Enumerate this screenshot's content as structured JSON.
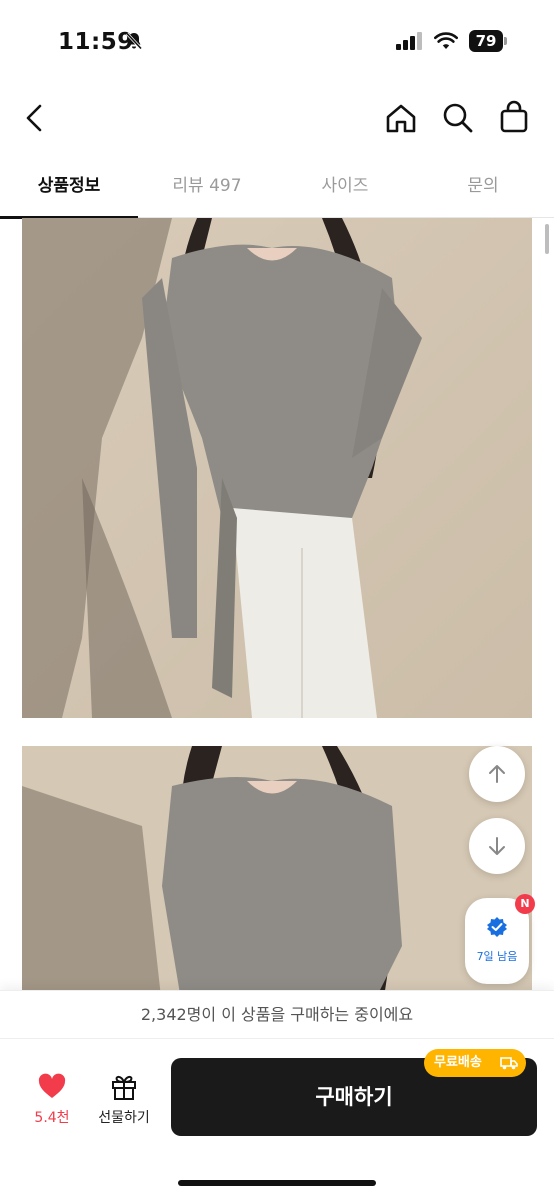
{
  "status_bar": {
    "time": "11:59",
    "battery": "79"
  },
  "nav": {
    "back": "back-icon",
    "home": "home-icon",
    "search": "search-icon",
    "bag": "shopping-bag-icon"
  },
  "tabs": [
    {
      "label": "상품정보",
      "active": true
    },
    {
      "label": "리뷰 497",
      "active": false
    },
    {
      "label": "사이즈",
      "active": false
    },
    {
      "label": "문의",
      "active": false
    }
  ],
  "floating": {
    "up": "arrow-up-icon",
    "down": "arrow-down-icon",
    "badge_text": "7일 남음",
    "badge_letter": "N"
  },
  "banner": {
    "text": "2,342명이 이 상품을 구매하는 중이에요"
  },
  "bottom": {
    "like_label": "5.4천",
    "gift_label": "선물하기",
    "buy_label": "구매하기",
    "free_ship": "무료배송"
  },
  "colors": {
    "like": "#f23c4b",
    "free_ship": "#ffb400",
    "buy_bg": "#1a1a1a",
    "badge_blue": "#1a6fe0"
  }
}
